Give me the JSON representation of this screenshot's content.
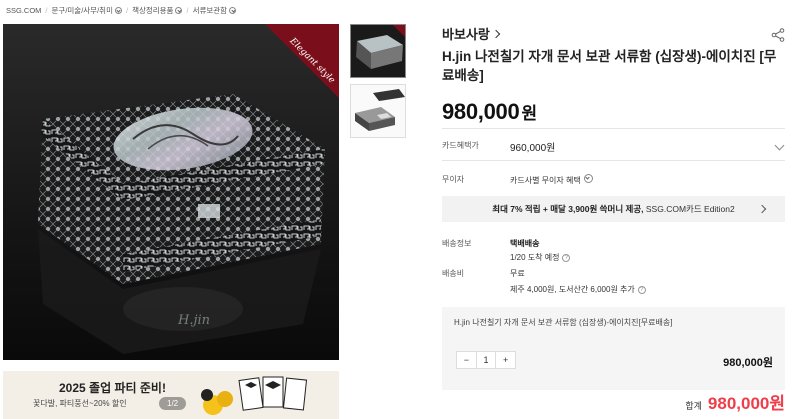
{
  "breadcrumb": {
    "items": [
      "SSG.COM",
      "문구/미술/사무/취미",
      "책상정리용품",
      "서류보관함"
    ]
  },
  "gallery": {
    "overlay_script": "Elegant style",
    "watermark": "H.jin"
  },
  "banner": {
    "title": "2025 졸업 파티 준비!",
    "subtitle": "꽃다발, 파티풍선~20% 할인",
    "pager": "1/2"
  },
  "product": {
    "brand": "바보사랑",
    "title": "H.jin 나전칠기 자개 문서 보관 서류함 (십장생)-에이치진 [무료배송]",
    "price": "980,000",
    "price_unit": "원"
  },
  "card": {
    "label": "카드혜택가",
    "value": "960,000원"
  },
  "interest_free": {
    "label": "무이자",
    "value": "카드사별 무이자 혜택"
  },
  "promo": {
    "bold_part": "최대 7% 적립 + 매달 3,900원 쓱머니 제공,",
    "rest": " SSG.COM카드 Edition2"
  },
  "shipping": {
    "label": "배송정보",
    "method": "택배배송",
    "eta": "1/20 도착 예정",
    "fee_label": "배송비",
    "fee": "무료",
    "jeju": "제주 4,000원, 도서산간 6,000원 추가"
  },
  "option": {
    "name": "H.jin 나전칠기 자개 문서 보관 서류함 (십장생)-에이치진[무료배송]",
    "qty": "1",
    "minus": "−",
    "plus": "+",
    "price": "980,000원"
  },
  "total": {
    "label": "합계",
    "value": "980,000원"
  },
  "colors": {
    "accent_red": "#ef3d4a",
    "promo_bg": "#f2f2f2",
    "option_bg": "#f5f5f5"
  }
}
